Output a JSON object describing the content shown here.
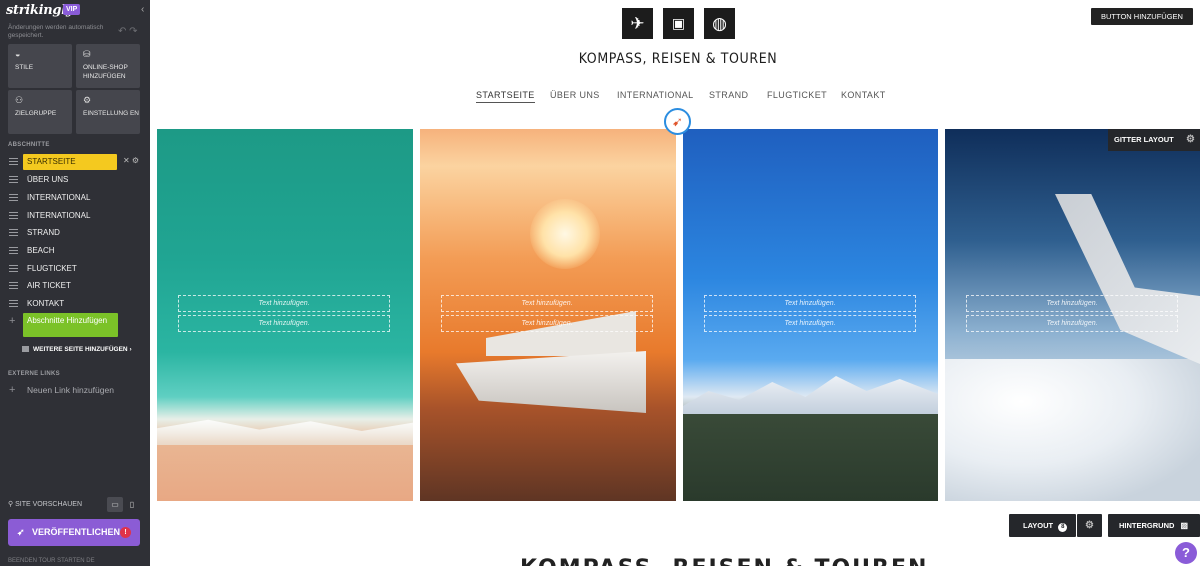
{
  "sidebar": {
    "logo": "strikingly",
    "vip": "VIP",
    "autosave": "Änderungen werden automatisch gespeichert.",
    "tiles": [
      {
        "icon": "palette-icon",
        "label": "STILE"
      },
      {
        "icon": "store-icon",
        "label": "ONLINE-SHOP HINZUFÜGEN"
      },
      {
        "icon": "audience-icon",
        "label": "ZIELGRUPPE"
      },
      {
        "icon": "gear-icon",
        "label": "EINSTELLUNG EN"
      }
    ],
    "sections_heading": "ABSCHNITTE",
    "sections": [
      "STARTSEITE",
      "ÜBER UNS",
      "INTERNATIONAL",
      "INTERNATIONAL",
      "STRAND",
      "BEACH",
      "FLUGTICKET",
      "AIR TICKET",
      "KONTAKT"
    ],
    "add_section": "Abschnitte Hinzufügen",
    "more_page": "WEITERE SEITE HINZUFÜGEN",
    "external_heading": "EXTERNE LINKS",
    "new_link": "Neuen Link hinzufügen",
    "preview": "SITE VORSCHAUEN",
    "publish": "VERÖFFENTLICHEN",
    "publish_alert": "!",
    "footer": "BEENDEN TOUR STARTEN DE"
  },
  "header": {
    "add_button": "BUTTON HINZUFÜGEN",
    "icons": [
      "airplane-icon",
      "suitcase-icon",
      "globe-icon"
    ],
    "brand": "KOMPASS, REISEN & TOUREN",
    "nav": [
      "STARTSEITE",
      "ÜBER UNS",
      "INTERNATIONAL",
      "STRAND",
      "FLUGTICKET",
      "KONTAKT"
    ]
  },
  "gallery": {
    "placeholder": "Text hinzufügen.",
    "panels": [
      "ocean-beach",
      "cruise-ship-sunset",
      "snowy-mountains",
      "airplane-wing-clouds"
    ]
  },
  "controls": {
    "gitter": "GITTER LAYOUT",
    "layout": "LAYOUT",
    "layout_count": "8",
    "hintergrund": "HINTERGRUND",
    "help": "?"
  },
  "section_title": "KOMPASS, REISEN & TOUREN",
  "colors": {
    "sidebar_bg": "#2f3036",
    "active_section": "#f4c91f",
    "add_section": "#7bc228",
    "publish": "#8b5cd5",
    "compass_ring": "#2b8de0"
  }
}
